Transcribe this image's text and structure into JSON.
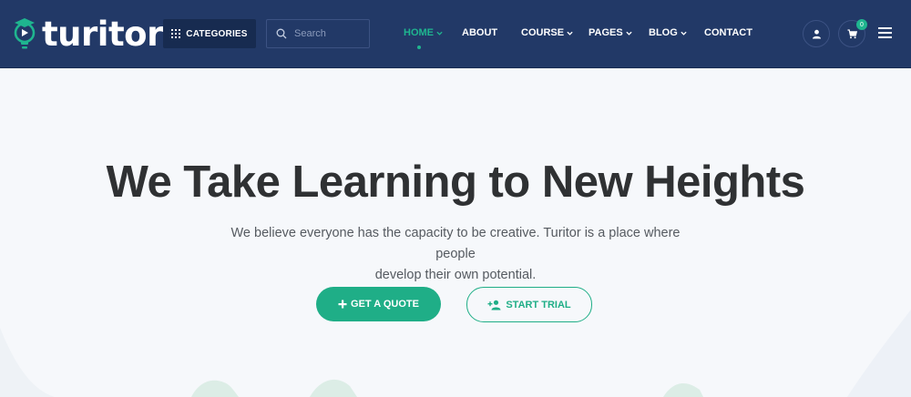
{
  "brand": {
    "name": "turitor"
  },
  "header": {
    "categories_label": "CATEGORIES",
    "search_placeholder": "Search",
    "nav": [
      {
        "label": "HOME",
        "active": true,
        "has_dropdown": true
      },
      {
        "label": "ABOUT",
        "active": false,
        "has_dropdown": false
      },
      {
        "label": "COURSE",
        "active": false,
        "has_dropdown": true
      },
      {
        "label": "PAGES",
        "active": false,
        "has_dropdown": true
      },
      {
        "label": "BLOG",
        "active": false,
        "has_dropdown": true
      },
      {
        "label": "CONTACT",
        "active": false,
        "has_dropdown": false
      }
    ],
    "cart_count": "0",
    "icons": [
      "grid-icon",
      "search-icon",
      "user-icon",
      "cart-icon",
      "menu-icon",
      "chevron-down-icon"
    ]
  },
  "hero": {
    "title": "We Take Learning to New Heights",
    "subtitle_line1": "We believe everyone has the capacity to be creative. Turitor is a place where people",
    "subtitle_line2": "develop their own potential.",
    "primary_button": "GET A QUOTE",
    "secondary_button": "START TRIAL"
  },
  "colors": {
    "header_bg": "#223967",
    "accent": "#1fae87",
    "page_bg": "#f6f8fb",
    "title_text": "#2f3133"
  }
}
